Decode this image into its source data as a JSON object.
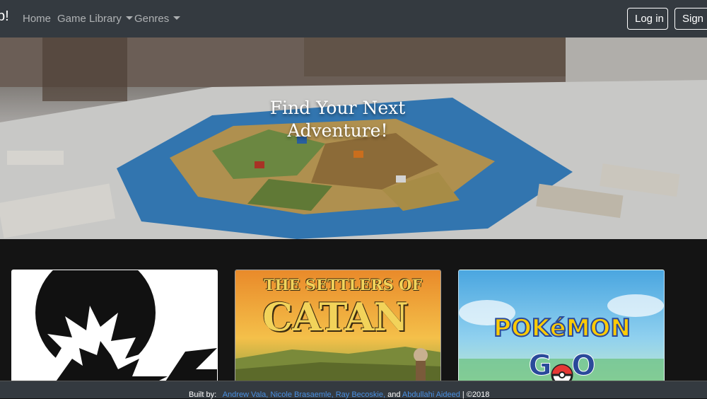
{
  "nav": {
    "brand": "p!",
    "links": [
      {
        "label": "Home"
      },
      {
        "label": "Game Library"
      },
      {
        "label": "Genres"
      }
    ],
    "login": "Log in",
    "signup": "Sign U"
  },
  "hero": {
    "title_line1": "Find Your Next",
    "title_line2": "Adventure!"
  },
  "cards": [
    {
      "name": "dungeons-dragons"
    },
    {
      "name": "settlers-of-catan",
      "line1": "THE SETTLERS OF",
      "line2": "CATAN"
    },
    {
      "name": "pokemon-go",
      "line1": "POKéMON",
      "line2": "GO"
    }
  ],
  "footer": {
    "built_by": "Built by:",
    "author1": "Andrew Vala,",
    "author2": "Nicole Brasaemle,",
    "author3": "Ray Becoskie,",
    "and": "and",
    "author4": "Abdullahi Aideed",
    "copyright": "| ©2018"
  }
}
